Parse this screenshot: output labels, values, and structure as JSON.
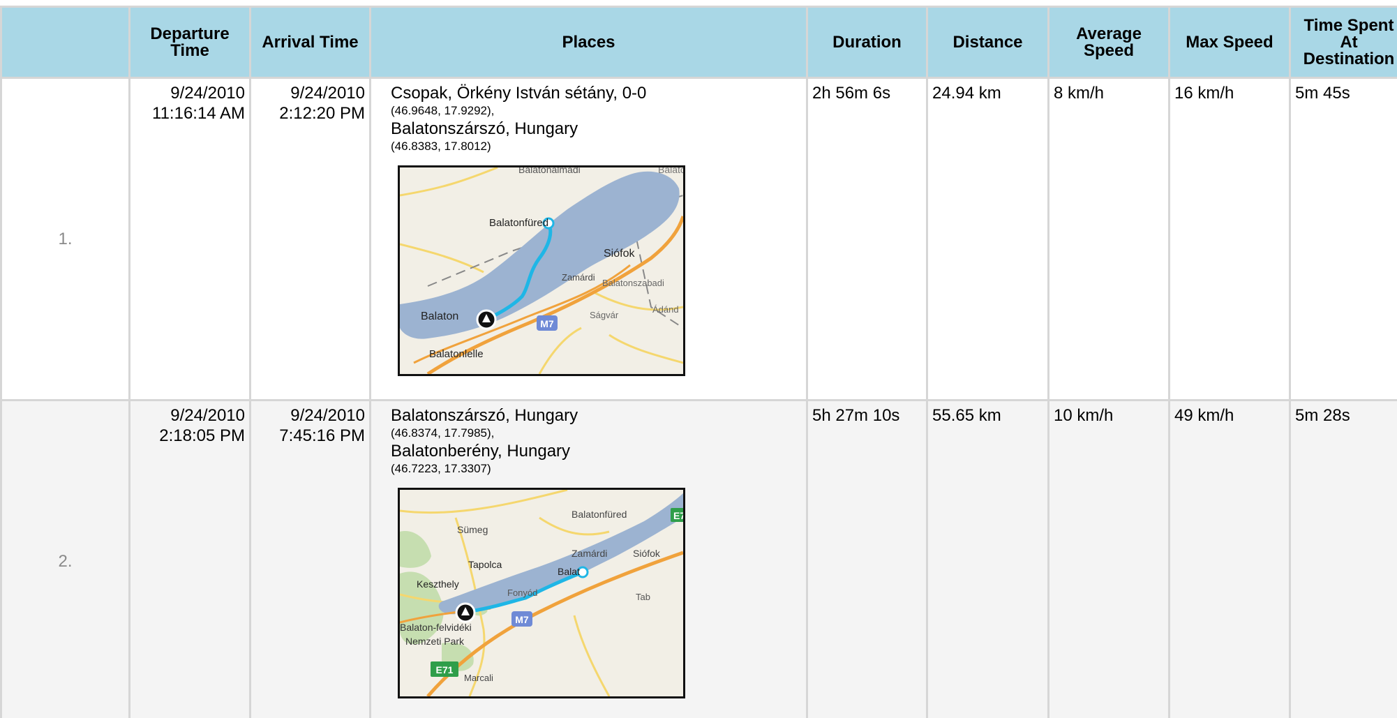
{
  "headers": {
    "number": "",
    "departure": "Departure Time",
    "arrival": "Arrival Time",
    "places": "Places",
    "duration": "Duration",
    "distance": "Distance",
    "avg_speed": "Average Speed",
    "max_speed": "Max Speed",
    "time_spent": "Time Spent At Destination"
  },
  "trips": [
    {
      "number": "1.",
      "departure_date": "9/24/2010",
      "departure_time": "11:16:14 AM",
      "arrival_date": "9/24/2010",
      "arrival_time": "2:12:20 PM",
      "from_name": "Csopak, Örkény István sétány, 0-0",
      "from_coord": "(46.9648, 17.9292),",
      "to_name": "Balatonszárszó, Hungary",
      "to_coord": "(46.8383, 17.8012)",
      "duration": "2h 56m 6s",
      "distance": "24.94 km",
      "avg_speed": "8 km/h",
      "max_speed": "16 km/h",
      "time_spent": "5m 45s",
      "map": {
        "labels": [
          "Balatonalmádi",
          "Balaton",
          "Balatonfüred",
          "Siófok",
          "Zamárdi",
          "Balatonszabadi",
          "Ádánd",
          "Ságvár",
          "Balaton",
          "Balatonlelle",
          "M7"
        ]
      }
    },
    {
      "number": "2.",
      "departure_date": "9/24/2010",
      "departure_time": "2:18:05 PM",
      "arrival_date": "9/24/2010",
      "arrival_time": "7:45:16 PM",
      "from_name": "Balatonszárszó, Hungary",
      "from_coord": "(46.8374, 17.7985),",
      "to_name": "Balatonberény, Hungary",
      "to_coord": "(46.7223, 17.3307)",
      "duration": "5h 27m 10s",
      "distance": "55.65 km",
      "avg_speed": "10 km/h",
      "max_speed": "49 km/h",
      "time_spent": "5m 28s",
      "map": {
        "labels": [
          "Balatonfüred",
          "E7",
          "Sümeg",
          "Tapolca",
          "Zamárdi",
          "Siófok",
          "Balat",
          "Keszthely",
          "Fonyód",
          "Tab",
          "M7",
          "Balaton-felvidéki",
          "Nemzeti Park",
          "E71",
          "Marcali"
        ]
      }
    }
  ],
  "colors": {
    "header_bg": "#a9d7e6",
    "row_alt_bg": "#f4f4f4",
    "border": "#d6d6d6",
    "lake": "#9cb3d1",
    "route": "#1fb6e6",
    "road_major": "#f0a23c",
    "road_minor": "#f5d76e",
    "forest": "#c6deb0",
    "motorway_shield": "#6f8ad6",
    "euro_shield": "#2f9e4a"
  }
}
